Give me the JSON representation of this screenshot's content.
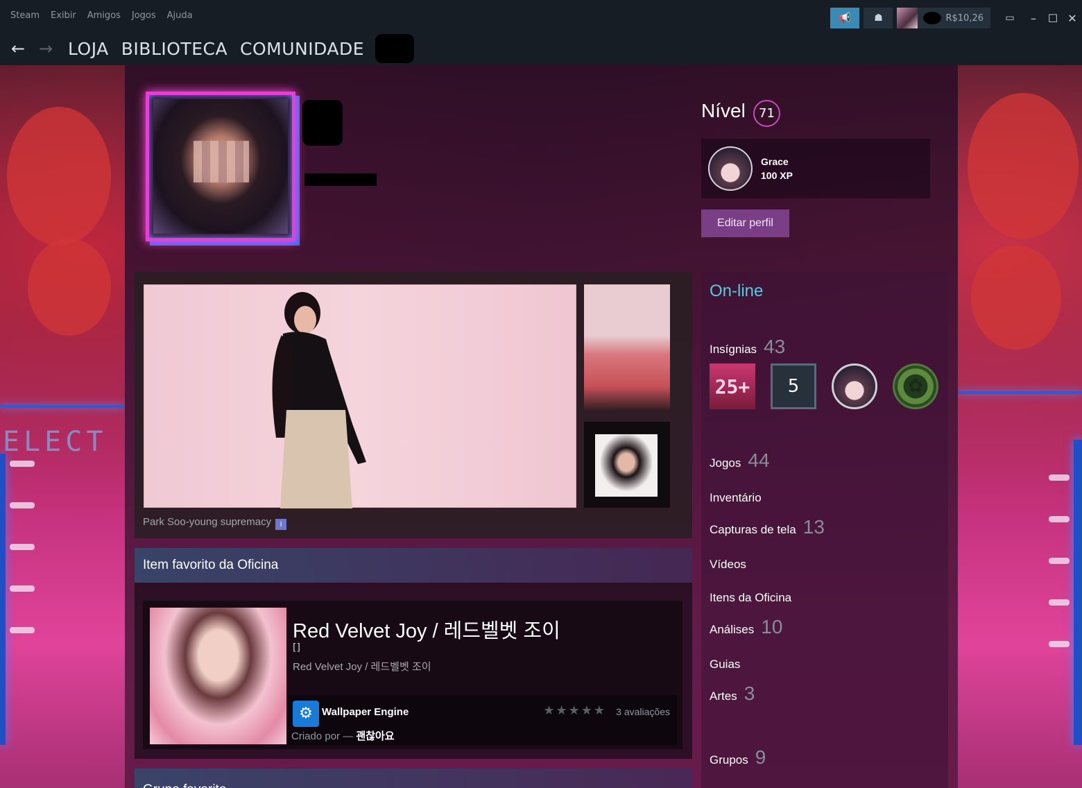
{
  "menu": {
    "items": [
      "Steam",
      "Exibir",
      "Amigos",
      "Jogos",
      "Ajuda"
    ]
  },
  "tray": {
    "wallet": "R$10,26"
  },
  "nav": {
    "links": [
      "LOJA",
      "BIBLIOTECA",
      "COMUNIDADE"
    ]
  },
  "background": {
    "sign_text": "ELECT"
  },
  "profile": {
    "level_label": "Nível",
    "level": "71",
    "featured_badge": {
      "name": "Grace",
      "xp": "100 XP"
    },
    "edit_label": "Editar perfil",
    "status": "On-line",
    "screenshot_caption": "Park Soo-young supremacy",
    "workshop_header": "Item favorito da Oficina",
    "workshop": {
      "title": "Red Velvet Joy / 레드벨벳 조이",
      "bracket": "[]",
      "subtitle": "Red Velvet Joy / 레드벨벳 조이",
      "app_name": "Wallpaper Engine",
      "stars": "★★★★★",
      "ratings": "3 avaliações",
      "created_by": "Criado por — ",
      "author": "괜찮아요"
    },
    "group_header": "Grupo favorito"
  },
  "sidebar": {
    "badges_label": "Insígnias",
    "badges_count": "43",
    "badge_25": "25+",
    "badge_5": "5",
    "games_label": "Jogos",
    "games_count": "44",
    "inventory_label": "Inventário",
    "screenshots_label": "Capturas de tela",
    "screenshots_count": "13",
    "videos_label": "Vídeos",
    "workshop_label": "Itens da Oficina",
    "reviews_label": "Análises",
    "reviews_count": "10",
    "guides_label": "Guias",
    "art_label": "Artes",
    "art_count": "3",
    "groups_label": "Grupos",
    "groups_count": "9"
  },
  "colors": {
    "status_online": "#57cbde",
    "level_ring": "#c64bbd",
    "edit_button": "#7a3e86"
  }
}
